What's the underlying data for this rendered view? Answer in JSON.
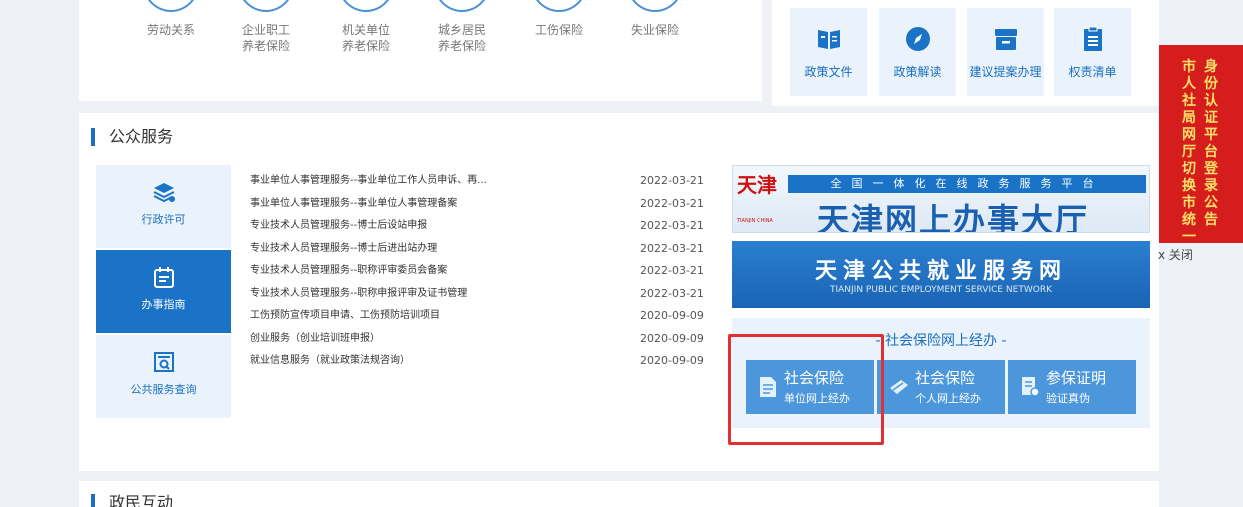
{
  "categories": [
    {
      "line1": "劳动关系",
      "line2": ""
    },
    {
      "line1": "企业职工",
      "line2": "养老保险"
    },
    {
      "line1": "机关单位",
      "line2": "养老保险"
    },
    {
      "line1": "城乡居民",
      "line2": "养老保险"
    },
    {
      "line1": "工伤保险",
      "line2": ""
    },
    {
      "line1": "失业保险",
      "line2": ""
    }
  ],
  "quick_tiles": [
    {
      "label": "政策文件",
      "icon": "book-icon"
    },
    {
      "label": "政策解读",
      "icon": "compass-icon"
    },
    {
      "label": "建议提案办理",
      "icon": "archive-box-icon"
    },
    {
      "label": "权责清单",
      "icon": "clipboard-icon"
    }
  ],
  "public_service": {
    "title": "公众服务",
    "sidebar": [
      {
        "label": "行政许可",
        "icon": "layers-star-icon",
        "active": false
      },
      {
        "label": "办事指南",
        "icon": "calendar-guide-icon",
        "active": true
      },
      {
        "label": "公共服务查询",
        "icon": "search-doc-icon",
        "active": false
      }
    ],
    "items": [
      {
        "title": "事业单位人事管理服务--事业单位工作人员申诉、再...",
        "date": "2022-03-21"
      },
      {
        "title": "事业单位人事管理服务--事业单位人事管理备案",
        "date": "2022-03-21"
      },
      {
        "title": "专业技术人员管理服务--博士后设站申报",
        "date": "2022-03-21"
      },
      {
        "title": "专业技术人员管理服务--博士后进出站办理",
        "date": "2022-03-21"
      },
      {
        "title": "专业技术人员管理服务--职称评审委员会备案",
        "date": "2022-03-21"
      },
      {
        "title": "专业技术人员管理服务--职称申报评审及证书管理",
        "date": "2022-03-21"
      },
      {
        "title": "工伤预防宣传项目申请、工伤预防培训项目",
        "date": "2020-09-09"
      },
      {
        "title": "创业服务（创业培训班申报）",
        "date": "2020-09-09"
      },
      {
        "title": "就业信息服务（就业政策法规咨询）",
        "date": "2020-09-09"
      }
    ],
    "banner_hall": {
      "seal": "天津",
      "seal_sub": "TIANJIN CHINA",
      "strip": "全国一体化在线政务服务平台",
      "title": "天津网上办事大厅"
    },
    "banner_employment": {
      "title": "天津公共就业服务网",
      "subtitle": "TIANJIN PUBLIC EMPLOYMENT SERVICE NETWORK"
    },
    "social_insurance": {
      "title": "- 社会保险网上经办 -",
      "buttons": [
        {
          "main": "社会保险",
          "sub": "单位网上经办",
          "icon": "document-icon"
        },
        {
          "main": "社会保险",
          "sub": "个人网上经办",
          "icon": "card-icon"
        },
        {
          "main": "参保证明",
          "sub": "验证真伪",
          "icon": "certificate-icon"
        }
      ]
    }
  },
  "bottom_section": {
    "title": "政民互动"
  },
  "notice": {
    "col1": "身份认证平台登录公告",
    "col2": "市人社局网厅切换市统一",
    "close": "x 关闭"
  },
  "colors": {
    "brand": "#1a73c6",
    "highlight": "#e03030",
    "notice": "#d61d1d"
  }
}
